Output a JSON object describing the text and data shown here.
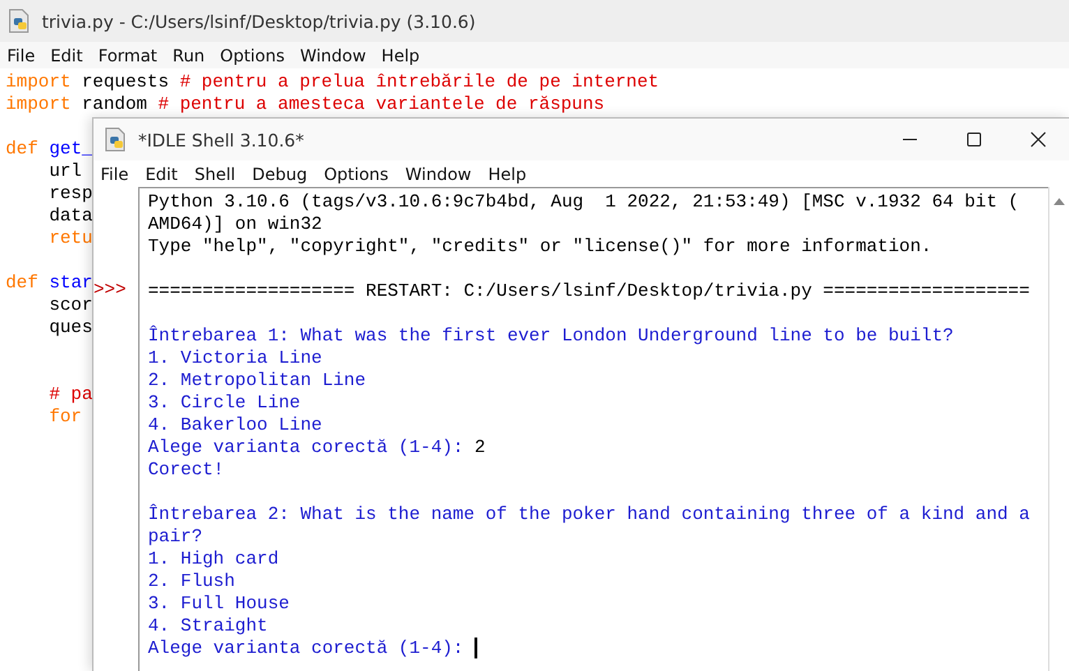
{
  "editor": {
    "title": "trivia.py - C:/Users/lsinf/Desktop/trivia.py (3.10.6)",
    "menu": [
      "File",
      "Edit",
      "Format",
      "Run",
      "Options",
      "Window",
      "Help"
    ],
    "code_lines": [
      {
        "kind": "code",
        "segments": [
          {
            "kind": "keyword",
            "text": "import "
          },
          {
            "kind": "plain",
            "text": "requests "
          },
          {
            "kind": "comment",
            "text": "# pentru a prelua întrebările de pe internet"
          }
        ]
      },
      {
        "kind": "code",
        "segments": [
          {
            "kind": "keyword",
            "text": "import "
          },
          {
            "kind": "plain",
            "text": "random "
          },
          {
            "kind": "comment",
            "text": "# pentru a amesteca variantele de răspuns"
          }
        ]
      },
      {
        "kind": "blank"
      },
      {
        "kind": "code",
        "segments": [
          {
            "kind": "keyword",
            "text": "def "
          },
          {
            "kind": "name",
            "text": "get_"
          }
        ]
      },
      {
        "kind": "code",
        "segments": [
          {
            "kind": "plain",
            "text": "    url"
          }
        ]
      },
      {
        "kind": "code",
        "segments": [
          {
            "kind": "plain",
            "text": "    resp"
          }
        ]
      },
      {
        "kind": "code",
        "segments": [
          {
            "kind": "plain",
            "text": "    data"
          }
        ]
      },
      {
        "kind": "code",
        "segments": [
          {
            "kind": "keyword",
            "text": "    retu"
          }
        ]
      },
      {
        "kind": "blank"
      },
      {
        "kind": "code",
        "segments": [
          {
            "kind": "keyword",
            "text": "def "
          },
          {
            "kind": "name",
            "text": "star"
          }
        ]
      },
      {
        "kind": "code",
        "segments": [
          {
            "kind": "plain",
            "text": "    scor"
          }
        ]
      },
      {
        "kind": "code",
        "segments": [
          {
            "kind": "plain",
            "text": "    ques"
          }
        ]
      },
      {
        "kind": "blank"
      },
      {
        "kind": "blank"
      },
      {
        "kind": "code",
        "segments": [
          {
            "kind": "comment",
            "text": "    # pa"
          }
        ]
      },
      {
        "kind": "code",
        "segments": [
          {
            "kind": "keyword",
            "text": "    for"
          }
        ]
      }
    ]
  },
  "shell": {
    "title": "*IDLE Shell 3.10.6*",
    "menu": [
      "File",
      "Edit",
      "Shell",
      "Debug",
      "Options",
      "Window",
      "Help"
    ],
    "prompt": ">>>",
    "lines": [
      {
        "kind": "banner",
        "text": "Python 3.10.6 (tags/v3.10.6:9c7b4bd, Aug  1 2022, 21:53:49) [MSC v.1932 64 bit ("
      },
      {
        "kind": "banner",
        "text": "AMD64)] on win32"
      },
      {
        "kind": "banner",
        "text": "Type \"help\", \"copyright\", \"credits\" or \"license()\" for more information."
      },
      {
        "kind": "blank"
      },
      {
        "kind": "restart",
        "text": "=================== RESTART: C:/Users/lsinf/Desktop/trivia.py ==================="
      },
      {
        "kind": "blank"
      },
      {
        "kind": "output",
        "text": "Întrebarea 1: What was the first ever London Underground line to be built?"
      },
      {
        "kind": "output",
        "text": "1. Victoria Line"
      },
      {
        "kind": "output",
        "text": "2. Metropolitan Line"
      },
      {
        "kind": "output",
        "text": "3. Circle Line"
      },
      {
        "kind": "output",
        "text": "4. Bakerloo Line"
      },
      {
        "kind": "input",
        "text": "Alege varianta corectă (1-4): ",
        "input": "2"
      },
      {
        "kind": "output",
        "text": "Corect!"
      },
      {
        "kind": "blank"
      },
      {
        "kind": "output",
        "text": "Întrebarea 2: What is the name of the poker hand containing three of a kind and a pair?"
      },
      {
        "kind": "output",
        "text": "1. High card"
      },
      {
        "kind": "output",
        "text": "2. Flush"
      },
      {
        "kind": "output",
        "text": "3. Full House"
      },
      {
        "kind": "output",
        "text": "4. Straight"
      },
      {
        "kind": "input",
        "text": "Alege varianta corectă (1-4): ",
        "cursor": true
      }
    ]
  }
}
